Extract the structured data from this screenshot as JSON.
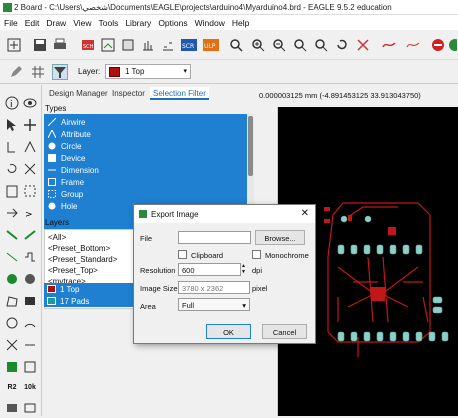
{
  "window": {
    "title": "2 Board - C:\\Users\\شخصي\\Documents\\EAGLE\\projects\\arduino4\\Myarduino4.brd - EAGLE 9.5.2 education"
  },
  "menu": [
    "File",
    "Edit",
    "Draw",
    "View",
    "Tools",
    "Library",
    "Options",
    "Window",
    "Help"
  ],
  "toolbar": {
    "layer_label": "Layer:",
    "layer_value": "1 Top",
    "scr_label": "SCR",
    "ulp_label": "ULP"
  },
  "panel": {
    "tabs": [
      "Design Manager",
      "Inspector",
      "Selection Filter"
    ],
    "active_tab": "Selection Filter",
    "types_heading": "Types",
    "types": [
      "Airwire",
      "Attribute",
      "Circle",
      "Device",
      "Dimension",
      "Frame",
      "Group",
      "Hole"
    ],
    "layers_heading": "Layers",
    "layers": [
      "<All>",
      "<Preset_Bottom>",
      "<Preset_Standard>",
      "<Preset_Top>",
      "<mvtrace>"
    ],
    "selected_layers": [
      "1 Top",
      "17 Pads"
    ],
    "left_strip_labels": {
      "r2": "R2",
      "k10": "10k"
    }
  },
  "status": {
    "coordinates": "0.000003125 mm (-4.891453125 33.913043750)"
  },
  "dialog": {
    "title": "Export Image",
    "file_label": "File",
    "file_value": "",
    "browse_label": "Browse...",
    "clipboard_label": "Clipboard",
    "monochrome_label": "Monochrome",
    "resolution_label": "Resolution",
    "resolution_value": "600",
    "resolution_unit": "dpi",
    "image_size_label": "Image Size",
    "image_size_value": "3780 x 2362",
    "image_size_unit": "pixel",
    "area_label": "Area",
    "area_value": "Full",
    "ok_label": "OK",
    "cancel_label": "Cancel"
  },
  "colors": {
    "accent": "#1f7fd0",
    "top_layer": "#b01010",
    "pads_layer": "#1f9a9a",
    "pcb_trace": "#c01818",
    "pad": "#8fcfc6"
  }
}
